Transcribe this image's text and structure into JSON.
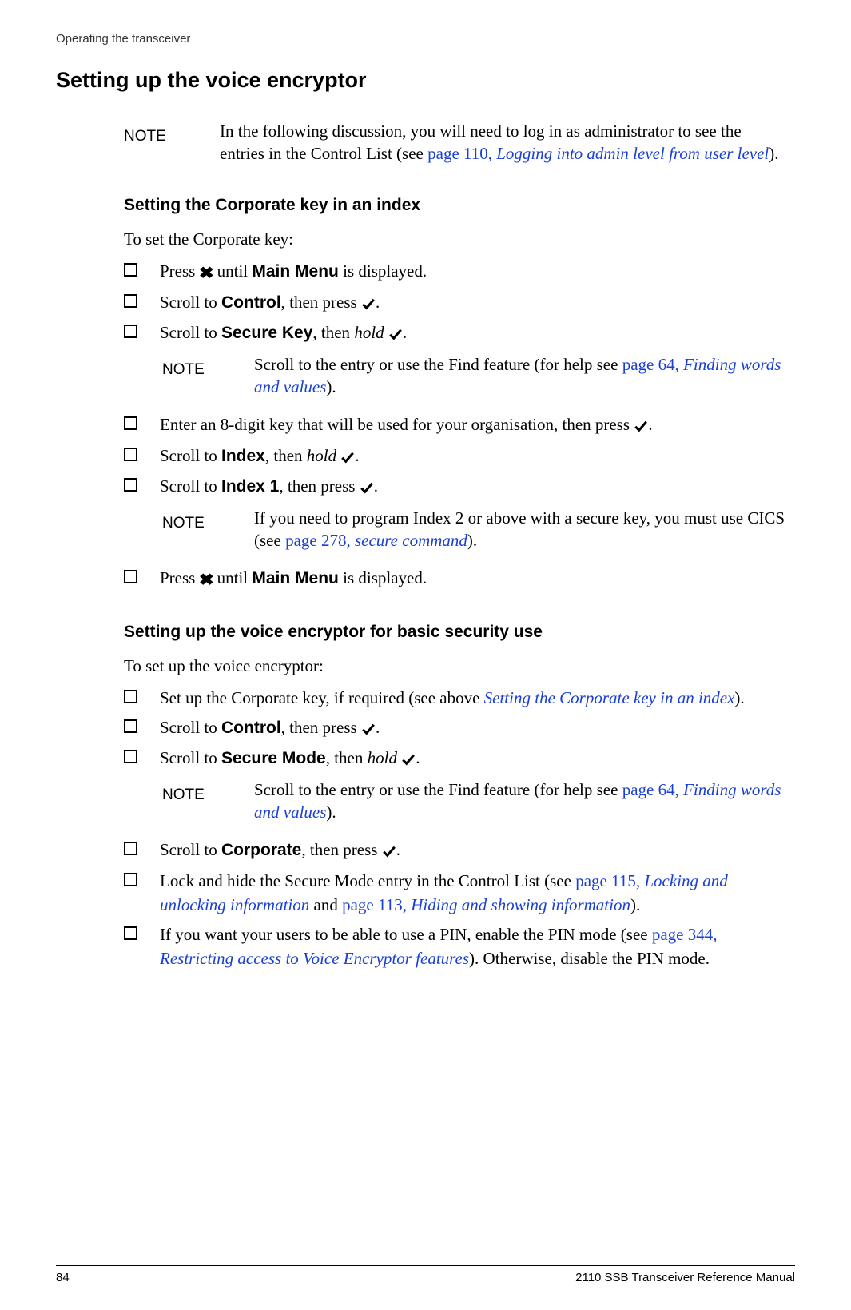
{
  "header": "Operating the transceiver",
  "title": "Setting up the voice encryptor",
  "note1": {
    "label": "NOTE",
    "text_pre": "In the following discussion, you will need to log in as administrator to see the entries in the Control List (see ",
    "link_page": "page 110, ",
    "link_text": "Logging into admin level from user level",
    "text_post": ")."
  },
  "sectionA": {
    "heading": "Setting the Corporate key in an index",
    "intro": "To set the Corporate key:",
    "items": [
      {
        "pre": "Press ",
        "icon": "x",
        "mid": " until ",
        "bold": "Main Menu",
        "post": " is displayed."
      },
      {
        "pre": "Scroll to ",
        "bold": "Control",
        "mid2": ", then press ",
        "icon2": "check",
        "post": "."
      },
      {
        "pre": "Scroll to ",
        "bold": "Secure Key",
        "mid2": ", then ",
        "ital": "hold",
        "sp": " ",
        "icon2": "check",
        "post": "."
      }
    ],
    "noteA": {
      "label": "NOTE",
      "text_pre": "Scroll to the entry or use the Find feature (for help see ",
      "link_page": "page 64, ",
      "link_text": "Finding words and values",
      "text_post": ")."
    },
    "items2": [
      {
        "text_pre": "Enter an 8-digit key that will be used for your organisation, then press ",
        "icon": "check",
        "post": "."
      },
      {
        "pre": "Scroll to ",
        "bold": "Index",
        "mid2": ", then ",
        "ital": "hold",
        "sp": " ",
        "icon2": "check",
        "post": "."
      },
      {
        "pre": "Scroll to ",
        "bold": "Index 1",
        "mid2": ", then press ",
        "icon2": "check",
        "post": "."
      }
    ],
    "noteB": {
      "label": "NOTE",
      "text_pre": "If you need to program Index 2 or above with a secure key, you must use CICS (see ",
      "link_page": "page 278, ",
      "link_text": "secure command",
      "text_post": ")."
    },
    "items3": [
      {
        "pre": "Press ",
        "icon": "x",
        "mid": " until ",
        "bold": "Main Menu",
        "post": " is displayed."
      }
    ]
  },
  "sectionB": {
    "heading": "Setting up the voice encryptor for basic security use",
    "intro": "To set up the voice encryptor:",
    "items": [
      {
        "text_pre": "Set up the Corporate key, if required (see above ",
        "link_text": "Setting the Corporate key in an index",
        "post": ")."
      },
      {
        "pre": "Scroll to ",
        "bold": "Control",
        "mid2": ", then press ",
        "icon2": "check",
        "post": "."
      },
      {
        "pre": "Scroll to ",
        "bold": "Secure Mode",
        "mid2": ", then ",
        "ital": "hold",
        "sp": " ",
        "icon2": "check",
        "post": "."
      }
    ],
    "noteC": {
      "label": "NOTE",
      "text_pre": "Scroll to the entry or use the Find feature (for help see ",
      "link_page": "page 64, ",
      "link_text": "Finding words and values",
      "text_post": ")."
    },
    "items2": [
      {
        "pre": "Scroll to ",
        "bold": "Corporate",
        "mid2": ", then press ",
        "icon2": "check",
        "post": "."
      },
      {
        "text_pre": "Lock and hide the Secure Mode entry in the Control List (see ",
        "link_page": "page 115, ",
        "link_text": "Locking and unlocking information",
        "mid": " and ",
        "link_page2": "page 113, ",
        "link_text2": "Hiding and showing information",
        "post": ")."
      },
      {
        "text_pre": "If you want your users to be able to use a PIN, enable the PIN mode (see ",
        "link_page": "page 344, ",
        "link_text": "Restricting access to Voice Encryptor features",
        "post": "). Otherwise, disable the PIN mode."
      }
    ]
  },
  "footer": {
    "page": "84",
    "manual": "2110 SSB Transceiver Reference Manual"
  }
}
